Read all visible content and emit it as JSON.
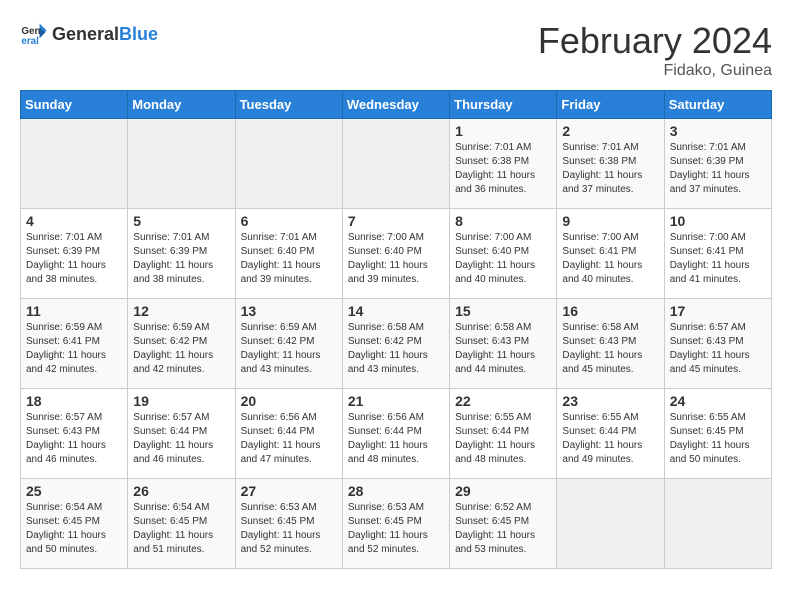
{
  "header": {
    "logo_general": "General",
    "logo_blue": "Blue",
    "month": "February 2024",
    "location": "Fidako, Guinea"
  },
  "weekdays": [
    "Sunday",
    "Monday",
    "Tuesday",
    "Wednesday",
    "Thursday",
    "Friday",
    "Saturday"
  ],
  "weeks": [
    [
      {
        "day": "",
        "sunrise": "",
        "sunset": "",
        "daylight": "",
        "empty": true
      },
      {
        "day": "",
        "sunrise": "",
        "sunset": "",
        "daylight": "",
        "empty": true
      },
      {
        "day": "",
        "sunrise": "",
        "sunset": "",
        "daylight": "",
        "empty": true
      },
      {
        "day": "",
        "sunrise": "",
        "sunset": "",
        "daylight": "",
        "empty": true
      },
      {
        "day": "1",
        "sunrise": "Sunrise: 7:01 AM",
        "sunset": "Sunset: 6:38 PM",
        "daylight": "Daylight: 11 hours and 36 minutes."
      },
      {
        "day": "2",
        "sunrise": "Sunrise: 7:01 AM",
        "sunset": "Sunset: 6:38 PM",
        "daylight": "Daylight: 11 hours and 37 minutes."
      },
      {
        "day": "3",
        "sunrise": "Sunrise: 7:01 AM",
        "sunset": "Sunset: 6:39 PM",
        "daylight": "Daylight: 11 hours and 37 minutes."
      }
    ],
    [
      {
        "day": "4",
        "sunrise": "Sunrise: 7:01 AM",
        "sunset": "Sunset: 6:39 PM",
        "daylight": "Daylight: 11 hours and 38 minutes."
      },
      {
        "day": "5",
        "sunrise": "Sunrise: 7:01 AM",
        "sunset": "Sunset: 6:39 PM",
        "daylight": "Daylight: 11 hours and 38 minutes."
      },
      {
        "day": "6",
        "sunrise": "Sunrise: 7:01 AM",
        "sunset": "Sunset: 6:40 PM",
        "daylight": "Daylight: 11 hours and 39 minutes."
      },
      {
        "day": "7",
        "sunrise": "Sunrise: 7:00 AM",
        "sunset": "Sunset: 6:40 PM",
        "daylight": "Daylight: 11 hours and 39 minutes."
      },
      {
        "day": "8",
        "sunrise": "Sunrise: 7:00 AM",
        "sunset": "Sunset: 6:40 PM",
        "daylight": "Daylight: 11 hours and 40 minutes."
      },
      {
        "day": "9",
        "sunrise": "Sunrise: 7:00 AM",
        "sunset": "Sunset: 6:41 PM",
        "daylight": "Daylight: 11 hours and 40 minutes."
      },
      {
        "day": "10",
        "sunrise": "Sunrise: 7:00 AM",
        "sunset": "Sunset: 6:41 PM",
        "daylight": "Daylight: 11 hours and 41 minutes."
      }
    ],
    [
      {
        "day": "11",
        "sunrise": "Sunrise: 6:59 AM",
        "sunset": "Sunset: 6:41 PM",
        "daylight": "Daylight: 11 hours and 42 minutes."
      },
      {
        "day": "12",
        "sunrise": "Sunrise: 6:59 AM",
        "sunset": "Sunset: 6:42 PM",
        "daylight": "Daylight: 11 hours and 42 minutes."
      },
      {
        "day": "13",
        "sunrise": "Sunrise: 6:59 AM",
        "sunset": "Sunset: 6:42 PM",
        "daylight": "Daylight: 11 hours and 43 minutes."
      },
      {
        "day": "14",
        "sunrise": "Sunrise: 6:58 AM",
        "sunset": "Sunset: 6:42 PM",
        "daylight": "Daylight: 11 hours and 43 minutes."
      },
      {
        "day": "15",
        "sunrise": "Sunrise: 6:58 AM",
        "sunset": "Sunset: 6:43 PM",
        "daylight": "Daylight: 11 hours and 44 minutes."
      },
      {
        "day": "16",
        "sunrise": "Sunrise: 6:58 AM",
        "sunset": "Sunset: 6:43 PM",
        "daylight": "Daylight: 11 hours and 45 minutes."
      },
      {
        "day": "17",
        "sunrise": "Sunrise: 6:57 AM",
        "sunset": "Sunset: 6:43 PM",
        "daylight": "Daylight: 11 hours and 45 minutes."
      }
    ],
    [
      {
        "day": "18",
        "sunrise": "Sunrise: 6:57 AM",
        "sunset": "Sunset: 6:43 PM",
        "daylight": "Daylight: 11 hours and 46 minutes."
      },
      {
        "day": "19",
        "sunrise": "Sunrise: 6:57 AM",
        "sunset": "Sunset: 6:44 PM",
        "daylight": "Daylight: 11 hours and 46 minutes."
      },
      {
        "day": "20",
        "sunrise": "Sunrise: 6:56 AM",
        "sunset": "Sunset: 6:44 PM",
        "daylight": "Daylight: 11 hours and 47 minutes."
      },
      {
        "day": "21",
        "sunrise": "Sunrise: 6:56 AM",
        "sunset": "Sunset: 6:44 PM",
        "daylight": "Daylight: 11 hours and 48 minutes."
      },
      {
        "day": "22",
        "sunrise": "Sunrise: 6:55 AM",
        "sunset": "Sunset: 6:44 PM",
        "daylight": "Daylight: 11 hours and 48 minutes."
      },
      {
        "day": "23",
        "sunrise": "Sunrise: 6:55 AM",
        "sunset": "Sunset: 6:44 PM",
        "daylight": "Daylight: 11 hours and 49 minutes."
      },
      {
        "day": "24",
        "sunrise": "Sunrise: 6:55 AM",
        "sunset": "Sunset: 6:45 PM",
        "daylight": "Daylight: 11 hours and 50 minutes."
      }
    ],
    [
      {
        "day": "25",
        "sunrise": "Sunrise: 6:54 AM",
        "sunset": "Sunset: 6:45 PM",
        "daylight": "Daylight: 11 hours and 50 minutes."
      },
      {
        "day": "26",
        "sunrise": "Sunrise: 6:54 AM",
        "sunset": "Sunset: 6:45 PM",
        "daylight": "Daylight: 11 hours and 51 minutes."
      },
      {
        "day": "27",
        "sunrise": "Sunrise: 6:53 AM",
        "sunset": "Sunset: 6:45 PM",
        "daylight": "Daylight: 11 hours and 52 minutes."
      },
      {
        "day": "28",
        "sunrise": "Sunrise: 6:53 AM",
        "sunset": "Sunset: 6:45 PM",
        "daylight": "Daylight: 11 hours and 52 minutes."
      },
      {
        "day": "29",
        "sunrise": "Sunrise: 6:52 AM",
        "sunset": "Sunset: 6:45 PM",
        "daylight": "Daylight: 11 hours and 53 minutes."
      },
      {
        "day": "",
        "sunrise": "",
        "sunset": "",
        "daylight": "",
        "empty": true
      },
      {
        "day": "",
        "sunrise": "",
        "sunset": "",
        "daylight": "",
        "empty": true
      }
    ]
  ]
}
